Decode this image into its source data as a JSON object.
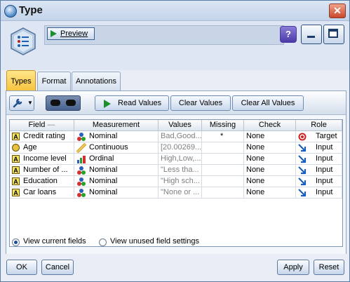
{
  "window": {
    "title": "Type"
  },
  "header": {
    "preview_label": "Preview",
    "help_label": "?"
  },
  "tabs": [
    {
      "label": "Types",
      "active": true
    },
    {
      "label": "Format",
      "active": false
    },
    {
      "label": "Annotations",
      "active": false
    }
  ],
  "toolbar": {
    "read_values": "Read Values",
    "clear_values": "Clear Values",
    "clear_all_values": "Clear All Values"
  },
  "table": {
    "columns": [
      "Field",
      "Measurement",
      "Values",
      "Missing",
      "Check",
      "Role"
    ],
    "rows": [
      {
        "field": "Credit rating",
        "field_icon": "string-icon",
        "measurement": "Nominal",
        "measurement_icon": "nominal-icon",
        "values": "Bad,Good...",
        "missing": "*",
        "check": "None",
        "role": "Target",
        "role_icon": "target-icon"
      },
      {
        "field": "Age",
        "field_icon": "real-icon",
        "measurement": "Continuous",
        "measurement_icon": "continuous-icon",
        "values": "[20.00269...",
        "missing": "",
        "check": "None",
        "role": "Input",
        "role_icon": "input-arrow-icon"
      },
      {
        "field": "Income level",
        "field_icon": "string-icon",
        "measurement": "Ordinal",
        "measurement_icon": "ordinal-icon",
        "values": "High,Low,...",
        "missing": "",
        "check": "None",
        "role": "Input",
        "role_icon": "input-arrow-icon"
      },
      {
        "field": "Number of ...",
        "field_icon": "string-icon",
        "measurement": "Nominal",
        "measurement_icon": "nominal-icon",
        "values": "\"Less tha...",
        "missing": "",
        "check": "None",
        "role": "Input",
        "role_icon": "input-arrow-icon"
      },
      {
        "field": "Education",
        "field_icon": "string-icon",
        "measurement": "Nominal",
        "measurement_icon": "nominal-icon",
        "values": "\"High sch...",
        "missing": "",
        "check": "None",
        "role": "Input",
        "role_icon": "input-arrow-icon"
      },
      {
        "field": "Car loans",
        "field_icon": "string-icon",
        "measurement": "Nominal",
        "measurement_icon": "nominal-icon",
        "values": "\"None or ...",
        "missing": "",
        "check": "None",
        "role": "Input",
        "role_icon": "input-arrow-icon"
      }
    ]
  },
  "view_options": {
    "current_fields": "View current fields",
    "unused_settings": "View unused field settings",
    "selected": "current_fields"
  },
  "buttons": {
    "ok": "OK",
    "cancel": "Cancel",
    "apply": "Apply",
    "reset": "Reset"
  },
  "colors": {
    "accent": "#f6c23a",
    "target": "#d02020",
    "input": "#1a5fc0"
  }
}
